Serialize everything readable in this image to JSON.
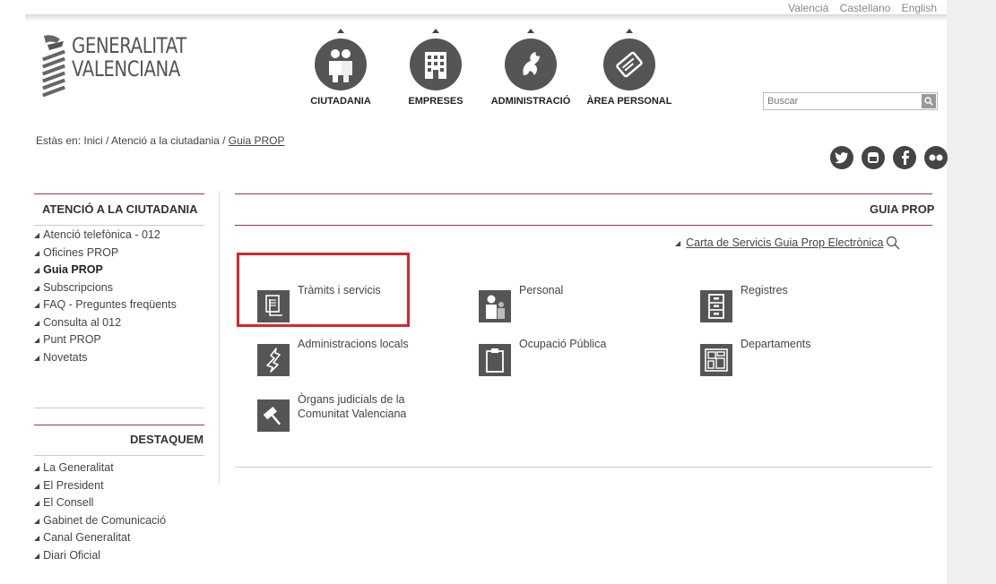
{
  "languages": [
    "Valencià",
    "Castellano",
    "English"
  ],
  "logo": {
    "line1": "GENERALITAT",
    "line2": "VALENCIANA"
  },
  "nav": [
    {
      "label": "CIUTADANIA",
      "icon": "people-icon"
    },
    {
      "label": "EMPRESES",
      "icon": "building-icon"
    },
    {
      "label": "ADMINISTRACIÓ",
      "icon": "dragon-icon"
    },
    {
      "label": "ÀREA PERSONAL",
      "icon": "card-icon"
    }
  ],
  "search": {
    "placeholder": "Buscar"
  },
  "breadcrumb": {
    "prefix": "Estàs en: Inici / Atenció a la ciutadania / ",
    "current": "Guia PROP"
  },
  "social": [
    "twitter-icon",
    "youtube-icon",
    "facebook-icon",
    "flickr-icon"
  ],
  "sidebar": {
    "title1": "ATENCIÓ A LA CIUTADANIA",
    "items1": [
      "Atenció telefònica - 012",
      "Oficines PROP",
      "Guia PROP",
      "Subscripcions",
      "FAQ - Preguntes freqüents",
      "Consulta al 012",
      "Punt PROP",
      "Novetats"
    ],
    "active": "Guia PROP",
    "title2": "DESTAQUEM",
    "items2": [
      "La Generalitat",
      "El President",
      "El Consell",
      "Gabinet de Comunicació",
      "Canal Generalitat",
      "Diari Oficial"
    ]
  },
  "main": {
    "title": "GUIA PROP",
    "carta_link": "Carta de Servicis Guia Prop Electrònica",
    "services": [
      {
        "label": "Tràmits i servicis",
        "icon": "documents-icon"
      },
      {
        "label": "Personal",
        "icon": "person-icon"
      },
      {
        "label": "Registres",
        "icon": "cabinet-icon"
      },
      {
        "label": "Administracions locals",
        "icon": "region-icon"
      },
      {
        "label": "Ocupació Pública",
        "icon": "clipboard-icon"
      },
      {
        "label": "Departaments",
        "icon": "floorplan-icon"
      },
      {
        "label": "Òrgans judicials de la Comunitat Valenciana",
        "icon": "gavel-icon"
      }
    ]
  },
  "colors": {
    "accent": "#a3334a",
    "highlight": "#d8262b",
    "icon_bg": "#555555"
  }
}
